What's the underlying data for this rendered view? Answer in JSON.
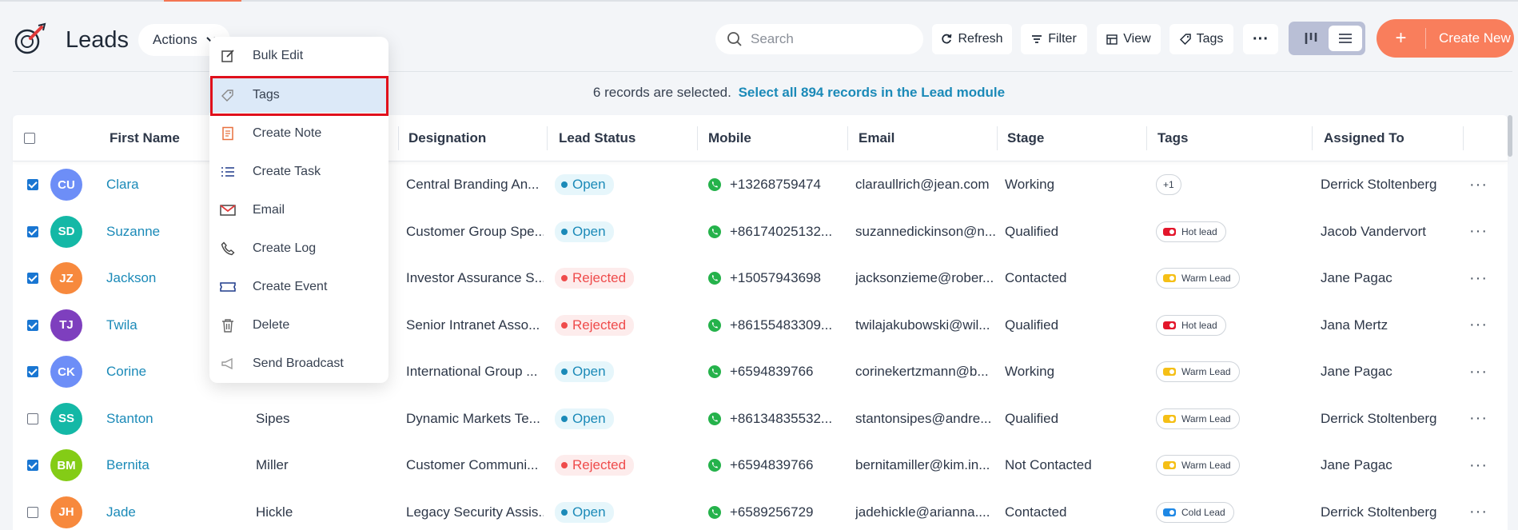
{
  "header": {
    "title": "Leads",
    "actions_label": "Actions",
    "search_placeholder": "Search",
    "refresh_label": "Refresh",
    "filter_label": "Filter",
    "view_label": "View",
    "tags_label": "Tags",
    "create_label": "Create New"
  },
  "selection": {
    "message": "6 records are selected.",
    "link": "Select all 894 records in the Lead module"
  },
  "actions_menu": {
    "items": [
      {
        "label": "Bulk Edit",
        "icon": "edit-icon"
      },
      {
        "label": "Tags",
        "icon": "tag-icon"
      },
      {
        "label": "Create Note",
        "icon": "note-icon"
      },
      {
        "label": "Create Task",
        "icon": "task-list-icon"
      },
      {
        "label": "Email",
        "icon": "envelope-icon"
      },
      {
        "label": "Create Log",
        "icon": "phone-icon"
      },
      {
        "label": "Create Event",
        "icon": "ticket-icon"
      },
      {
        "label": "Delete",
        "icon": "trash-icon"
      },
      {
        "label": "Send Broadcast",
        "icon": "megaphone-icon"
      }
    ],
    "highlighted": "Tags"
  },
  "table": {
    "columns": [
      "First Name",
      "Designation",
      "Lead Status",
      "Mobile",
      "Email",
      "Stage",
      "Tags",
      "Assigned To"
    ],
    "rows": [
      {
        "checked": true,
        "initials": "CU",
        "avatar_color": "#6d8ef7",
        "first_name": "Clara",
        "last_name": "",
        "designation": "Central Branding An...",
        "status": "Open",
        "mobile": "+13268759474",
        "email": "claraullrich@jean.com",
        "stage": "Working",
        "tag": "+1",
        "tag_color": "",
        "assigned": "Derrick Stoltenberg"
      },
      {
        "checked": true,
        "initials": "SD",
        "avatar_color": "#14b8a6",
        "first_name": "Suzanne",
        "last_name": "",
        "designation": "Customer Group Spe...",
        "status": "Open",
        "mobile": "+86174025132...",
        "email": "suzannedickinson@n...",
        "stage": "Qualified",
        "tag": "Hot lead",
        "tag_color": "#e3162b",
        "assigned": "Jacob Vandervort"
      },
      {
        "checked": true,
        "initials": "JZ",
        "avatar_color": "#f7893d",
        "first_name": "Jackson",
        "last_name": "",
        "designation": "Investor Assurance S...",
        "status": "Rejected",
        "mobile": "+15057943698",
        "email": "jacksonzieme@rober...",
        "stage": "Contacted",
        "tag": "Warm Lead",
        "tag_color": "#f5bf16",
        "assigned": "Jane Pagac"
      },
      {
        "checked": true,
        "initials": "TJ",
        "avatar_color": "#7e3fbe",
        "first_name": "Twila",
        "last_name": "",
        "designation": "Senior Intranet Asso...",
        "status": "Rejected",
        "mobile": "+86155483309...",
        "email": "twilajakubowski@wil...",
        "stage": "Qualified",
        "tag": "Hot lead",
        "tag_color": "#e3162b",
        "assigned": "Jana Mertz"
      },
      {
        "checked": true,
        "initials": "CK",
        "avatar_color": "#6d8ef7",
        "first_name": "Corine",
        "last_name": "",
        "designation": "International Group ...",
        "status": "Open",
        "mobile": "+6594839766",
        "email": "corinekertzmann@b...",
        "stage": "Working",
        "tag": "Warm Lead",
        "tag_color": "#f5bf16",
        "assigned": "Jane Pagac"
      },
      {
        "checked": false,
        "initials": "SS",
        "avatar_color": "#14b8a6",
        "first_name": "Stanton",
        "last_name": "Sipes",
        "designation": "Dynamic Markets Te...",
        "status": "Open",
        "mobile": "+86134835532...",
        "email": "stantonsipes@andre...",
        "stage": "Qualified",
        "tag": "Warm Lead",
        "tag_color": "#f5bf16",
        "assigned": "Derrick Stoltenberg"
      },
      {
        "checked": true,
        "initials": "BM",
        "avatar_color": "#84cc16",
        "first_name": "Bernita",
        "last_name": "Miller",
        "designation": "Customer Communi...",
        "status": "Rejected",
        "mobile": "+6594839766",
        "email": "bernitamiller@kim.in...",
        "stage": "Not Contacted",
        "tag": "Warm Lead",
        "tag_color": "#f5bf16",
        "assigned": "Jane Pagac"
      },
      {
        "checked": false,
        "initials": "JH",
        "avatar_color": "#f7893d",
        "first_name": "Jade",
        "last_name": "Hickle",
        "designation": "Legacy Security Assis...",
        "status": "Open",
        "mobile": "+6589256729",
        "email": "jadehickle@arianna....",
        "stage": "Contacted",
        "tag": "Cold Lead",
        "tag_color": "#1e88e5",
        "assigned": "Derrick Stoltenberg"
      }
    ]
  }
}
